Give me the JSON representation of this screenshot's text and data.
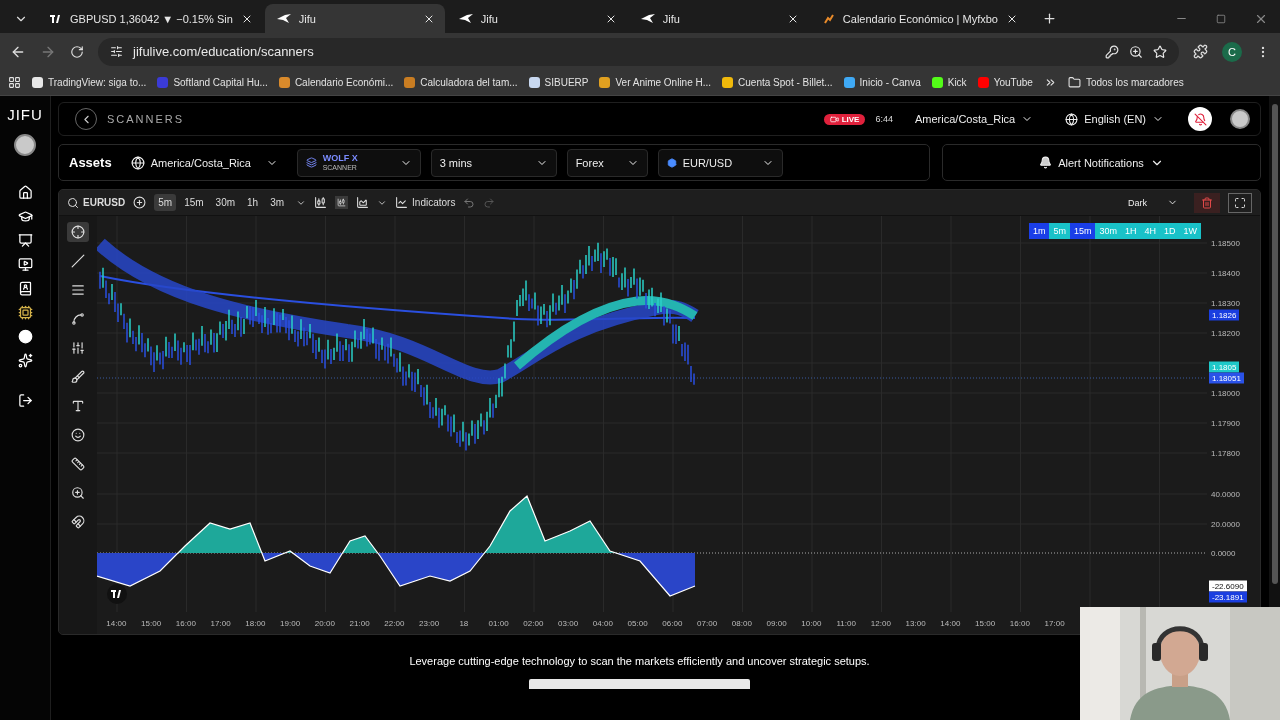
{
  "browser": {
    "tabs": [
      {
        "title": "GBPUSD 1,36042 ▼ −0.15% Sin",
        "kind": "tradingview",
        "selected": false
      },
      {
        "title": "Jifu",
        "kind": "jifu",
        "selected": true
      },
      {
        "title": "Jifu",
        "kind": "jifu",
        "selected": false
      },
      {
        "title": "Jifu",
        "kind": "jifu",
        "selected": false
      },
      {
        "title": "Calendario Económico | Myfxbo",
        "kind": "fx",
        "selected": false
      }
    ],
    "url": "jifulive.com/education/scanners",
    "profile": "C",
    "bookmarks": [
      {
        "label": "TradingView: siga to...",
        "color": "#e8e8e8"
      },
      {
        "label": "Softland Capital Hu...",
        "color": "#3b3bd6"
      },
      {
        "label": "Calendario Económi...",
        "color": "#d98a2b"
      },
      {
        "label": "Calculadora del tam...",
        "color": "#c97d22"
      },
      {
        "label": "SIBUERP",
        "color": "#c8d8f0"
      },
      {
        "label": "Ver Anime Online H...",
        "color": "#e0a020"
      },
      {
        "label": "Cuenta Spot - Billet...",
        "color": "#f0b90b"
      },
      {
        "label": "Inicio - Canva",
        "color": "#3fa9f5"
      },
      {
        "label": "Kick",
        "color": "#53fc18"
      },
      {
        "label": "YouTube",
        "color": "#ff0000"
      }
    ],
    "all_bookmarks": "Todos los marcadores"
  },
  "nav": {
    "logo": "JIFU",
    "items": [
      {
        "kind": "home"
      },
      {
        "kind": "education"
      },
      {
        "kind": "reader"
      },
      {
        "kind": "video"
      },
      {
        "kind": "book"
      },
      {
        "kind": "chip"
      },
      {
        "kind": "dot"
      },
      {
        "kind": "sparkle"
      },
      {
        "kind": "logout"
      }
    ]
  },
  "header": {
    "title": "SCANNERS",
    "live": "LIVE",
    "time": "6:44",
    "timezone": "America/Costa_Rica",
    "language": "English (EN)"
  },
  "assets": {
    "title": "Assets",
    "filters": [
      {
        "kind": "timezone",
        "value": "America/Costa_Rica"
      },
      {
        "kind": "scanner",
        "value": "WOLF X",
        "sub": "SCANNER"
      },
      {
        "kind": "plain",
        "value": "3 mins"
      },
      {
        "kind": "plain",
        "value": "Forex"
      },
      {
        "kind": "pair",
        "value": "EUR/USD"
      }
    ],
    "alerts": "Alert Notifications"
  },
  "toolbar": {
    "symbol": "EURUSD",
    "intervals": [
      {
        "label": "5m",
        "selected": true
      },
      {
        "label": "15m",
        "selected": false
      },
      {
        "label": "30m",
        "selected": false
      },
      {
        "label": "1h",
        "selected": false
      },
      {
        "label": "3m",
        "selected": false
      }
    ],
    "indicators": "Indicators",
    "theme": "Dark"
  },
  "chart": {
    "timeframes": [
      {
        "label": "1m",
        "color": "#1a3ee8"
      },
      {
        "label": "5m",
        "color": "#19c2c8"
      },
      {
        "label": "15m",
        "color": "#1a3ee8"
      },
      {
        "label": "30m",
        "color": "#19c2c8"
      },
      {
        "label": "1H",
        "color": "#19c2c8"
      },
      {
        "label": "4H",
        "color": "#19c2c8"
      },
      {
        "label": "1D",
        "color": "#19c2c8"
      },
      {
        "label": "1W",
        "color": "#19c2c8"
      }
    ],
    "price_ticks": [
      "1.18500",
      "1.18400",
      "1.18300",
      "1.18200",
      "1.18000",
      "1.17900",
      "1.17800"
    ],
    "price_badges": [
      {
        "label": "1.1826",
        "color": "#1a3ee0"
      },
      {
        "label": "1.1805",
        "color": "#1ec8c8"
      },
      {
        "label": "1.18051",
        "color": "#2a52e8"
      }
    ],
    "osc_ticks": [
      "40.0000",
      "20.0000",
      "0.0000"
    ],
    "osc_badges": [
      {
        "label": "-22.6090",
        "color": "#ffffff"
      },
      {
        "label": "-23.1891",
        "color": "#1a3ee0"
      }
    ],
    "time_ticks": [
      "14:00",
      "15:00",
      "16:00",
      "17:00",
      "18:00",
      "19:00",
      "20:00",
      "21:00",
      "22:00",
      "23:00",
      "18",
      "01:00",
      "02:00",
      "03:00",
      "04:00",
      "05:00",
      "06:00",
      "07:00",
      "08:00",
      "09:00",
      "10:00",
      "11:00",
      "12:00",
      "13:00",
      "14:00",
      "15:00",
      "16:00",
      "17:00"
    ]
  },
  "footer": {
    "caption": "Leverage cutting-edge technology to scan the markets efficiently and uncover strategic setups."
  }
}
